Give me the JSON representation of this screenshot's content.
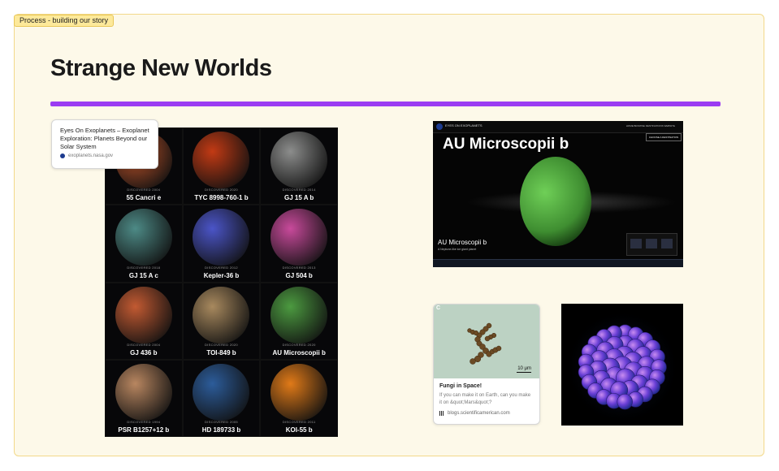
{
  "frame": {
    "label": "Process - building our story"
  },
  "page": {
    "title": "Strange New Worlds"
  },
  "colors": {
    "accent": "#9b3cf2",
    "frame_bg": "#fdf9e9",
    "label_bg": "#fde99a"
  },
  "planet_grid": {
    "planets": [
      {
        "name": "55 Cancri e",
        "discovered": "DISCOVERED 2004",
        "color": "#c4552a"
      },
      {
        "name": "TYC 8998-760-1 b",
        "discovered": "DISCOVERED 2020",
        "color": "#c23a14"
      },
      {
        "name": "GJ 15 A b",
        "discovered": "DISCOVERED 2014",
        "color": "#8c8d8c"
      },
      {
        "name": "GJ 15 A c",
        "discovered": "DISCOVERED 2018",
        "color": "#4d8a86"
      },
      {
        "name": "Kepler-36 b",
        "discovered": "DISCOVERED 2012",
        "color": "#4b55c8"
      },
      {
        "name": "GJ 504 b",
        "discovered": "DISCOVERED 2013",
        "color": "#c84a9b"
      },
      {
        "name": "GJ 436 b",
        "discovered": "DISCOVERED 2004",
        "color": "#c25a32"
      },
      {
        "name": "TOI-849 b",
        "discovered": "DISCOVERED 2020",
        "color": "#a8895e"
      },
      {
        "name": "AU Microscopii b",
        "discovered": "DISCOVERED 2020",
        "color": "#4c9a40"
      },
      {
        "name": "PSR B1257+12 b",
        "discovered": "DISCOVERED 1994",
        "color": "#b88660"
      },
      {
        "name": "HD 189733 b",
        "discovered": "DISCOVERED 2005",
        "color": "#2c5c9a"
      },
      {
        "name": "KOI-55 b",
        "discovered": "DISCOVERED 2011",
        "color": "#e07a18"
      }
    ]
  },
  "link_card": {
    "title": "Eyes On Exoplanets – Exoplanet Exploration: Planets Beyond our Solar System",
    "url": "exoplanets.nasa.gov"
  },
  "au_screen": {
    "brand": "EYES ON EXOPLANETS",
    "nav": "HOME   BROWSE DESTINATIONS   WEBSITE",
    "choose": "CHOOSE A DESTINATION",
    "title": "AU Microscopii b",
    "planet_label": "AU Microscopii b",
    "planet_sub": "A Neptune-like ice giant planet"
  },
  "fungi_card": {
    "panel_tag": "C",
    "scale": "10 μm",
    "title": "Fungi in Space!",
    "description": "If you can make it on Earth, can you make it on &quot;Mars&quot;?",
    "url": "blogs.scientificamerican.com"
  }
}
